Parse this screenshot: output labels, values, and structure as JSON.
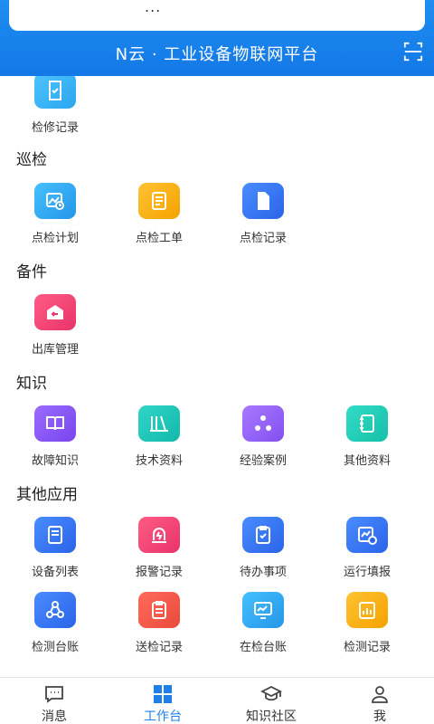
{
  "header": {
    "pill_text": "...",
    "title": "N云 · 工业设备物联网平台"
  },
  "sections": {
    "inspection": "巡检",
    "spare": "备件",
    "knowledge": "知识",
    "other": "其他应用"
  },
  "items": {
    "repair_record": "检修记录",
    "patrol_plan": "点检计划",
    "patrol_order": "点检工单",
    "patrol_record": "点检记录",
    "outbound": "出库管理",
    "fault_knowledge": "故障知识",
    "tech_material": "技术资料",
    "experience_case": "经验案例",
    "other_material": "其他资料",
    "device_list": "设备列表",
    "alarm_record": "报警记录",
    "todo": "待办事项",
    "run_report": "运行填报",
    "test_ledger": "检测台账",
    "send_record": "送检记录",
    "onsite_ledger": "在检台账",
    "test_record": "检测记录"
  },
  "tabs": {
    "messages": "消息",
    "workbench": "工作台",
    "community": "知识社区",
    "me": "我"
  },
  "colors": {
    "header_blue": "#1a82ec",
    "active_tab": "#1f7fe8"
  }
}
